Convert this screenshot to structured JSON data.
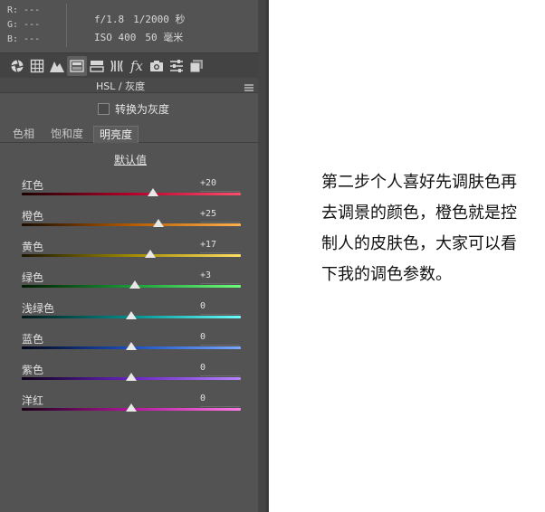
{
  "info": {
    "rgb": [
      "R: ---",
      "G: ---",
      "B: ---"
    ],
    "aperture": "f/1.8",
    "shutter": "1/2000 秒",
    "iso": "ISO 400",
    "focal": "50 毫米"
  },
  "toolbar": {
    "icons": [
      "aperture-icon",
      "grid-icon",
      "mountain-icon",
      "hsl-icon",
      "split-tone-icon",
      "lens-icon",
      "fx-icon",
      "camera-icon",
      "sliders-icon",
      "presets-icon"
    ]
  },
  "section": {
    "title": "HSL / 灰度"
  },
  "grayscale": {
    "label": "转换为灰度",
    "checked": false
  },
  "tabs": [
    "色相",
    "饱和度",
    "明亮度"
  ],
  "active_tab": "明亮度",
  "default_label": "默认值",
  "sliders": [
    {
      "label": "红色",
      "value": "+20",
      "level": 20,
      "colors": [
        "#1a0000",
        "#b5002a",
        "#ff4d6d"
      ]
    },
    {
      "label": "橙色",
      "value": "+25",
      "level": 25,
      "colors": [
        "#1a0b00",
        "#b35a00",
        "#ffb14d"
      ]
    },
    {
      "label": "黄色",
      "value": "+17",
      "level": 17,
      "colors": [
        "#1a1600",
        "#a08a00",
        "#ffe066"
      ]
    },
    {
      "label": "绿色",
      "value": "+3",
      "level": 3,
      "colors": [
        "#001a00",
        "#1a9b3a",
        "#6dff7a"
      ]
    },
    {
      "label": "浅绿色",
      "value": "0",
      "level": 0,
      "colors": [
        "#001a1a",
        "#008f8f",
        "#6dffff"
      ]
    },
    {
      "label": "蓝色",
      "value": "0",
      "level": 0,
      "colors": [
        "#00061a",
        "#1d4fbf",
        "#78a8ff"
      ]
    },
    {
      "label": "紫色",
      "value": "0",
      "level": 0,
      "colors": [
        "#0d001a",
        "#6a22c2",
        "#b684ff"
      ]
    },
    {
      "label": "洋红",
      "value": "0",
      "level": 0,
      "colors": [
        "#1a0016",
        "#b3169b",
        "#ff7de6"
      ]
    }
  ],
  "caption": "第二步个人喜好先调肤色再去调景的颜色，橙色就是控制人的皮肤色，大家可以看下我的调色参数。"
}
